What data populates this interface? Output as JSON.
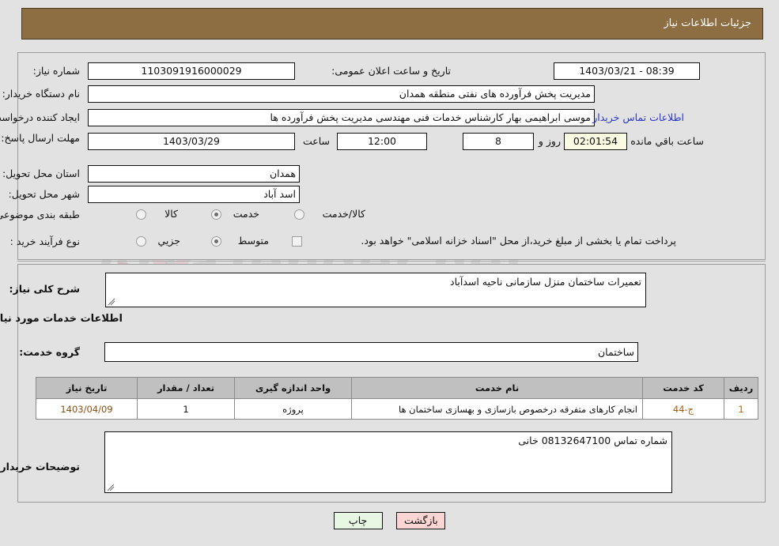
{
  "header": {
    "title": "جزئیات اطلاعات نیاز"
  },
  "top": {
    "need_number_label": "شماره نیاز:",
    "need_number_value": "1103091916000029",
    "announce_label": "تاریخ و ساعت اعلان عمومی:",
    "announce_value": "08:39 - 1403/03/21",
    "buyer_org_label": "نام دستگاه خریدار:",
    "buyer_org_value": "مدیریت پخش فرآورده های نفتی منطقه همدان",
    "requester_label": "ایجاد کننده درخواست:",
    "requester_value": "موسی ابراهیمی بهار کارشناس خدمات فنی مهندسی مدیریت پخش فرآورده ها",
    "contact_link": "اطلاعات تماس خریدار",
    "deadline_label": "مهلت ارسال پاسخ: تا تاریخ:",
    "deadline_date": "1403/03/29",
    "hour_label": "ساعت",
    "deadline_time": "12:00",
    "days_value": "8",
    "days_label": "روز و",
    "remaining_value": "02:01:54",
    "remaining_label": "ساعت باقي مانده",
    "province_label": "استان محل تحویل:",
    "province_value": "همدان",
    "city_label": "شهر محل تحویل:",
    "city_value": "اسد آباد",
    "category_label": "طبقه بندی موضوعی:",
    "category_options": [
      {
        "label": "کالا",
        "selected": false
      },
      {
        "label": "خدمت",
        "selected": true
      },
      {
        "label": "کالا/خدمت",
        "selected": false
      }
    ],
    "process_label": "نوع فرآیند خرید :",
    "process_options": [
      {
        "label": "جزیي",
        "selected": false
      },
      {
        "label": "متوسط",
        "selected": true
      }
    ],
    "treasury_checkbox_label": "پرداخت تمام یا بخشی از مبلغ خرید،از محل \"اسناد خزانه اسلامی\" خواهد بود.",
    "treasury_checked": false
  },
  "middle": {
    "general_desc_label": "شرح کلی نیاز:",
    "general_desc_value": "تعمیرات ساختمان منزل سازمانی ناحیه اسدآباد",
    "services_section_title": "اطلاعات خدمات مورد نیاز",
    "service_group_label": "گروه خدمت:",
    "service_group_value": "ساختمان"
  },
  "table": {
    "columns": [
      "ردیف",
      "کد خدمت",
      "نام خدمت",
      "واحد اندازه گیری",
      "تعداد / مقدار",
      "تاریخ نیاز"
    ],
    "rows": [
      {
        "index": "1",
        "code": "ج-44",
        "name": "انجام کارهای متفرقه درخصوص بازسازی و بهسازی ساختمان ها",
        "unit": "پروژه",
        "quantity": "1",
        "date": "1403/04/09"
      }
    ]
  },
  "comments": {
    "label": "توضیحات خریدار:",
    "value": "شماره تماس 08132647100 خانی"
  },
  "buttons": {
    "print": "چاپ",
    "back": "بازگشت"
  },
  "watermark": {
    "text": "ArtaTender.net"
  },
  "colors": {
    "header_brown": "#8d6e43",
    "page_bg": "#e2e2e2",
    "link_blue": "#2b35c8",
    "print_green": "#e8f6e4",
    "back_pink": "#fbd4d4",
    "table_header_gray": "#c0c0c0"
  }
}
